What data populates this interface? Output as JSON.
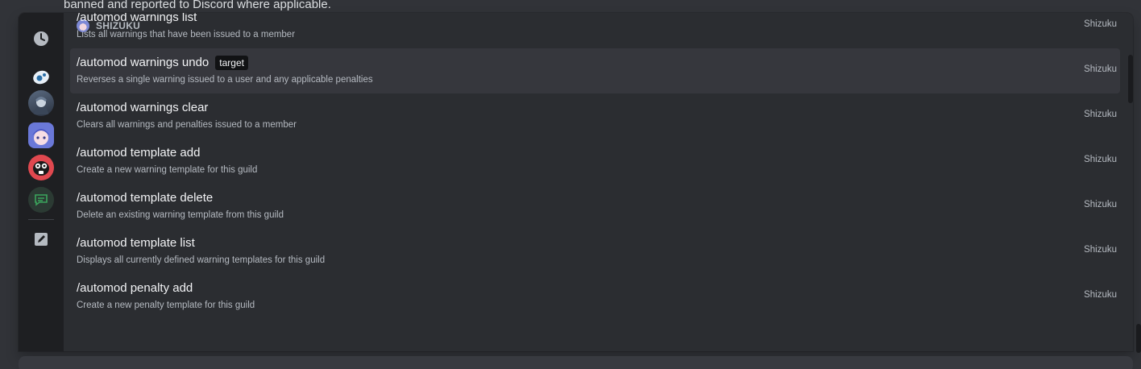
{
  "background": {
    "message_text": "banned and reported to Discord where applicable."
  },
  "rail": {
    "items": [
      {
        "name": "recent",
        "icon": "clock-icon"
      },
      {
        "name": "app-1",
        "icon": "eye-app-icon"
      },
      {
        "name": "app-2",
        "icon": "dark-avatar-icon"
      },
      {
        "name": "app-3",
        "icon": "shizuku-avatar-icon"
      },
      {
        "name": "app-4",
        "icon": "red-creature-icon"
      },
      {
        "name": "app-5",
        "icon": "chat-bubble-icon"
      },
      {
        "name": "built-in",
        "icon": "pencil-icon"
      }
    ]
  },
  "section": {
    "header": "SHIZUKU"
  },
  "commands": [
    {
      "name": "/automod warnings list",
      "option": "",
      "description": "Lists all warnings that have been issued to a member",
      "source": "Shizuku"
    },
    {
      "name": "/automod warnings undo",
      "option": "target",
      "description": "Reverses a single warning issued to a user and any applicable penalties",
      "source": "Shizuku",
      "selected": true
    },
    {
      "name": "/automod warnings clear",
      "option": "",
      "description": "Clears all warnings and penalties issued to a member",
      "source": "Shizuku"
    },
    {
      "name": "/automod template add",
      "option": "",
      "description": "Create a new warning template for this guild",
      "source": "Shizuku"
    },
    {
      "name": "/automod template delete",
      "option": "",
      "description": "Delete an existing warning template from this guild",
      "source": "Shizuku"
    },
    {
      "name": "/automod template list",
      "option": "",
      "description": "Displays all currently defined warning templates for this guild",
      "source": "Shizuku"
    },
    {
      "name": "/automod penalty add",
      "option": "",
      "description": "Create a new penalty template for this guild",
      "source": "Shizuku"
    }
  ],
  "colors": {
    "popup_bg": "#2b2d31",
    "rail_bg": "#1e1f22",
    "selected_row": "#36373d",
    "app_bg": "#313338"
  }
}
